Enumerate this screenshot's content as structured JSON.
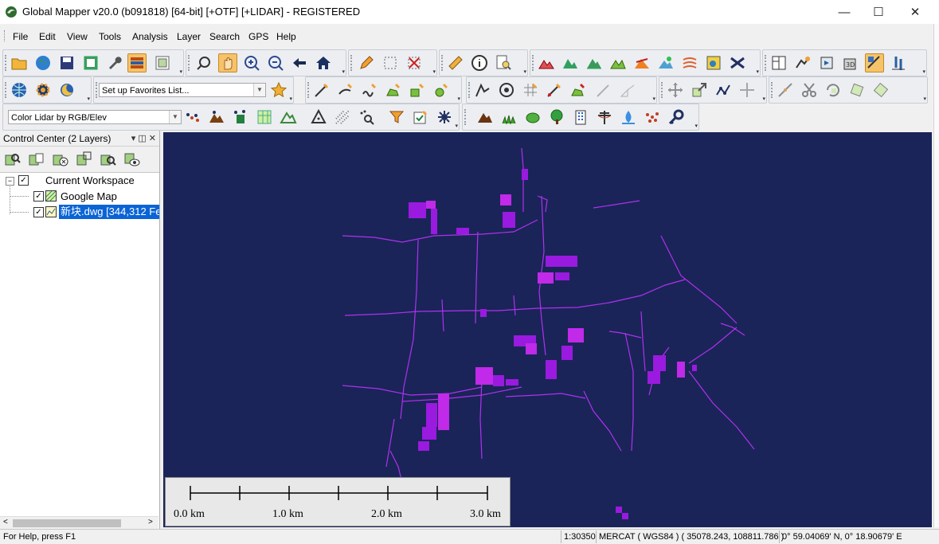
{
  "window": {
    "title": "Global Mapper v20.0 (b091818) [64-bit] [+OTF] [+LIDAR] - REGISTERED",
    "minimize": "—",
    "maximize": "☐",
    "close": "✕"
  },
  "menu": [
    "File",
    "Edit",
    "View",
    "Tools",
    "Analysis",
    "Layer",
    "Search",
    "GPS",
    "Help"
  ],
  "toolbar": {
    "favorites_placeholder": "Set up Favorites List...",
    "lidar_color_mode": "Color Lidar by RGB/Elev"
  },
  "control_center": {
    "title": "Control Center (2 Layers)",
    "pin": "▾ ◫ ✕",
    "workspace_label": "Current Workspace",
    "layers": [
      {
        "name": "Google Map",
        "checked": true
      },
      {
        "name": "新块.dwg [344,312 Fe",
        "checked": true,
        "selected": true
      }
    ]
  },
  "scale_bar": {
    "labels": [
      "0.0 km",
      "1.0 km",
      "2.0 km",
      "3.0 km"
    ]
  },
  "status": {
    "help": "For Help, press F1",
    "scale": "1:30350",
    "projection": "MERCAT ( WGS84 ) ( 35078.243, 108811.786 )",
    "coords": "0° 59.04069' N, 0° 18.90679' E"
  },
  "colors": {
    "map_background": "#1a2458",
    "feature_line": "#b030f0",
    "feature_fill": "#9a1adf",
    "selection": "#0a64d6"
  }
}
